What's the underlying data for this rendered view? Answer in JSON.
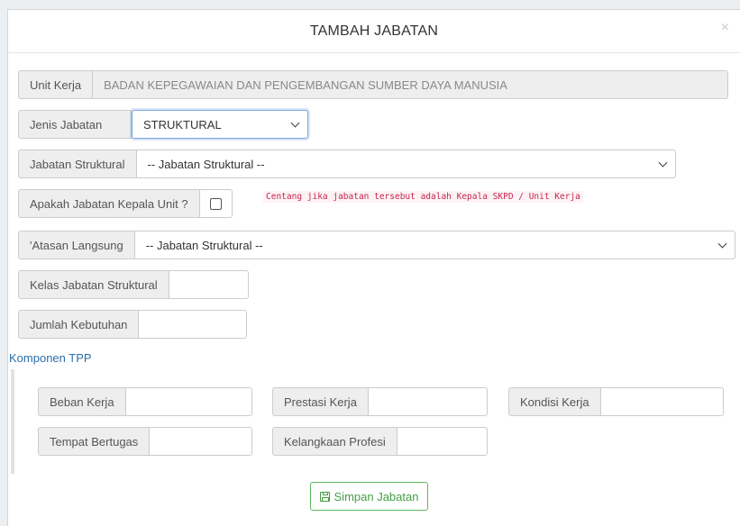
{
  "modal": {
    "title": "TAMBAH JABATAN",
    "close_label": "×"
  },
  "form": {
    "unit_kerja": {
      "label": "Unit Kerja",
      "value": "BADAN KEPEGAWAIAN DAN PENGEMBANGAN SUMBER DAYA MANUSIA"
    },
    "jenis_jabatan": {
      "label": "Jenis Jabatan",
      "value": "STRUKTURAL"
    },
    "jabatan_struktural": {
      "label": "Jabatan Struktural",
      "value": "-- Jabatan Struktural --"
    },
    "kepala_unit": {
      "label": "Apakah Jabatan Kepala Unit ?",
      "hint": "Centang jika jabatan tersebut adalah Kepala SKPD / Unit Kerja"
    },
    "atasan_langsung": {
      "label": "'Atasan Langsung",
      "value": "-- Jabatan Struktural --"
    },
    "kelas_jabatan": {
      "label": "Kelas Jabatan Struktural",
      "value": ""
    },
    "jumlah_kebutuhan": {
      "label": "Jumlah Kebutuhan",
      "value": ""
    }
  },
  "tpp": {
    "title": "Komponen TPP",
    "beban_kerja": "Beban Kerja",
    "prestasi_kerja": "Prestasi Kerja",
    "kondisi_kerja": "Kondisi Kerja",
    "tempat_bertugas": "Tempat Bertugas",
    "kelangkaan_profesi": "Kelangkaan Profesi"
  },
  "actions": {
    "save_label": "Simpan Jabatan"
  },
  "colors": {
    "accent_success": "#5cb85c",
    "link": "#2a6fa8",
    "hint_text": "#c7254e"
  }
}
